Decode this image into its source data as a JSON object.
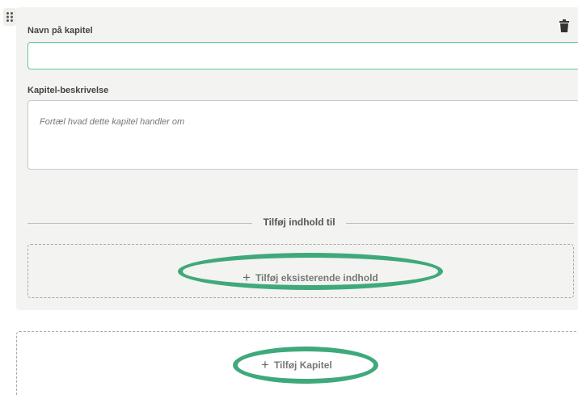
{
  "chapter": {
    "name_label": "Navn på kapitel",
    "name_value": "",
    "description_label": "Kapitel-beskrivelse",
    "description_placeholder": "Fortæl hvad dette kapitel handler om",
    "add_content_divider": "Tilføj indhold til",
    "add_existing_button": "Tilføj eksisterende indhold"
  },
  "add_chapter_button": "Tilføj Kapitel",
  "icons": {
    "drag": "drag-handle-icon",
    "delete": "trash-icon",
    "add": "plus-icon"
  },
  "colors": {
    "card_background": "#f3f3f1",
    "input_focus_border": "#5fcba0",
    "highlight_annotation": "#3fa97b",
    "dashed_border": "#a8a8a8"
  }
}
